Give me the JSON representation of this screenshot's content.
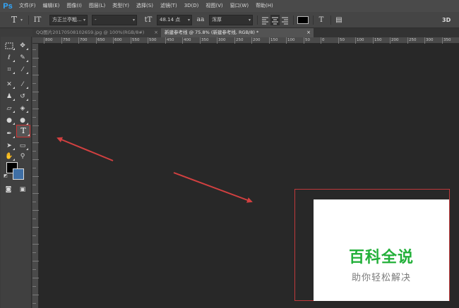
{
  "app": {
    "logo": "Ps"
  },
  "menu": [
    "文件(F)",
    "编辑(E)",
    "图像(I)",
    "图层(L)",
    "类型(Y)",
    "选择(S)",
    "滤镜(T)",
    "3D(D)",
    "视图(V)",
    "窗口(W)",
    "帮助(H)"
  ],
  "options": {
    "tool_glyph": "T",
    "orientation_glyph": "IT",
    "font_family": "方正兰亭粗...",
    "font_style": "-",
    "size_glyph": "tT",
    "font_size": "48.14 点",
    "aa_glyph": "aa",
    "antialias": "浑厚",
    "text_color": "#000000",
    "warp_glyph": "T",
    "panel_glyph": "▤",
    "threed": "3D"
  },
  "tabs": [
    {
      "label": "QQ图片20170508102659.jpg @ 100%(RGB/8#)",
      "close": "×",
      "active": false
    },
    {
      "label": "新建参考线 @ 75.8% (新建参考线, RGB/8) *",
      "close": "×",
      "active": true
    }
  ],
  "ruler_labels": [
    "800",
    "750",
    "700",
    "650",
    "600",
    "550",
    "500",
    "450",
    "400",
    "350",
    "300",
    "250",
    "200",
    "150",
    "100",
    "50",
    "0",
    "50",
    "100",
    "150",
    "200",
    "250",
    "300",
    "350",
    "400",
    "450",
    "500",
    "550",
    "600",
    "650",
    "700"
  ],
  "colors": {
    "foreground": "#000000",
    "background": "#3f6fa5",
    "accent_red": "#d24040",
    "brand_green": "#23b03a"
  },
  "watermark": {
    "title": "百科全说",
    "subtitle": "助你轻松解决"
  }
}
